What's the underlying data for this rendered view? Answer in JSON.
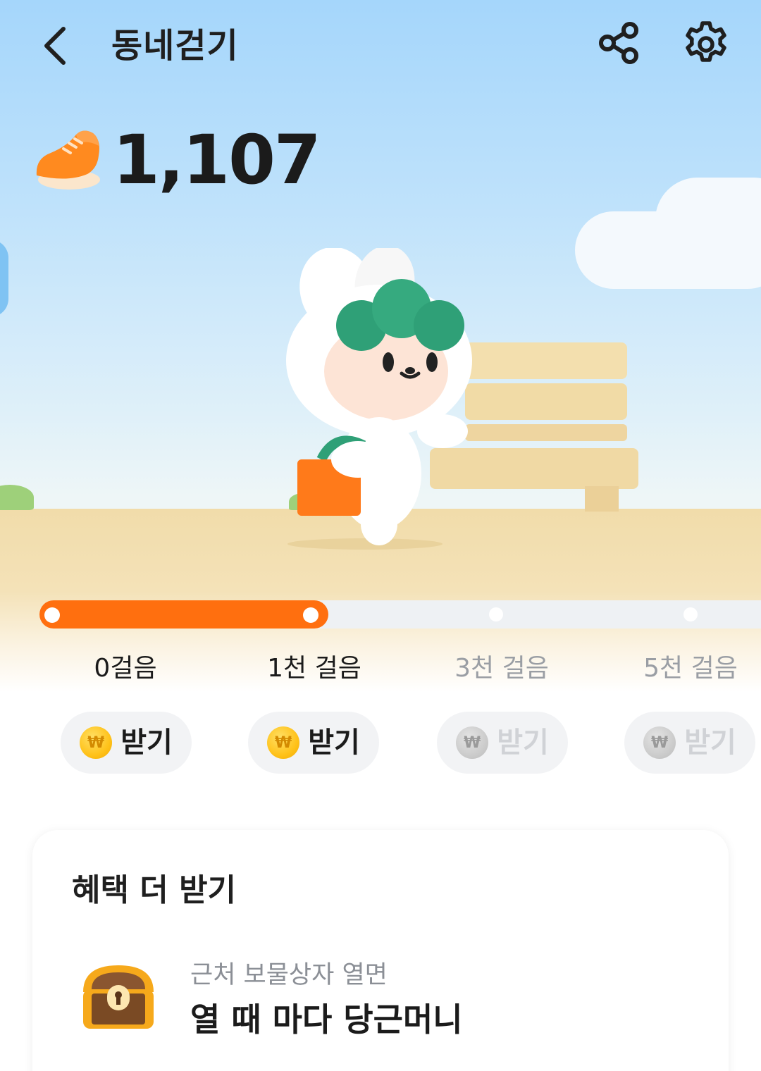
{
  "header": {
    "title": "동네걷기",
    "back_icon": "chevron-left-icon",
    "share_icon": "share-icon",
    "settings_icon": "gear-icon"
  },
  "steps": {
    "count": "1,107",
    "icon": "sneaker-icon"
  },
  "progress": {
    "fill_fraction": 0.4,
    "milestones": [
      {
        "label": "0걸음",
        "reached": true
      },
      {
        "label": "1천 걸음",
        "reached": true
      },
      {
        "label": "3천 걸음",
        "reached": false
      },
      {
        "label": "5천 걸음",
        "reached": false
      }
    ]
  },
  "rewards": [
    {
      "label": "받기",
      "enabled": true
    },
    {
      "label": "받기",
      "enabled": true
    },
    {
      "label": "받기",
      "enabled": false
    },
    {
      "label": "받기",
      "enabled": false
    }
  ],
  "coin_symbol": "₩",
  "benefits_card": {
    "title": "혜택 더 받기",
    "item": {
      "icon": "treasure-chest-icon",
      "subtitle": "근처 보물상자 열면",
      "title": "열 때 마다 당근머니"
    }
  },
  "colors": {
    "accent": "#ff6f0f",
    "text_primary": "#1b1b1b",
    "text_disabled": "#9a9ea4",
    "button_bg": "#f2f3f5"
  }
}
